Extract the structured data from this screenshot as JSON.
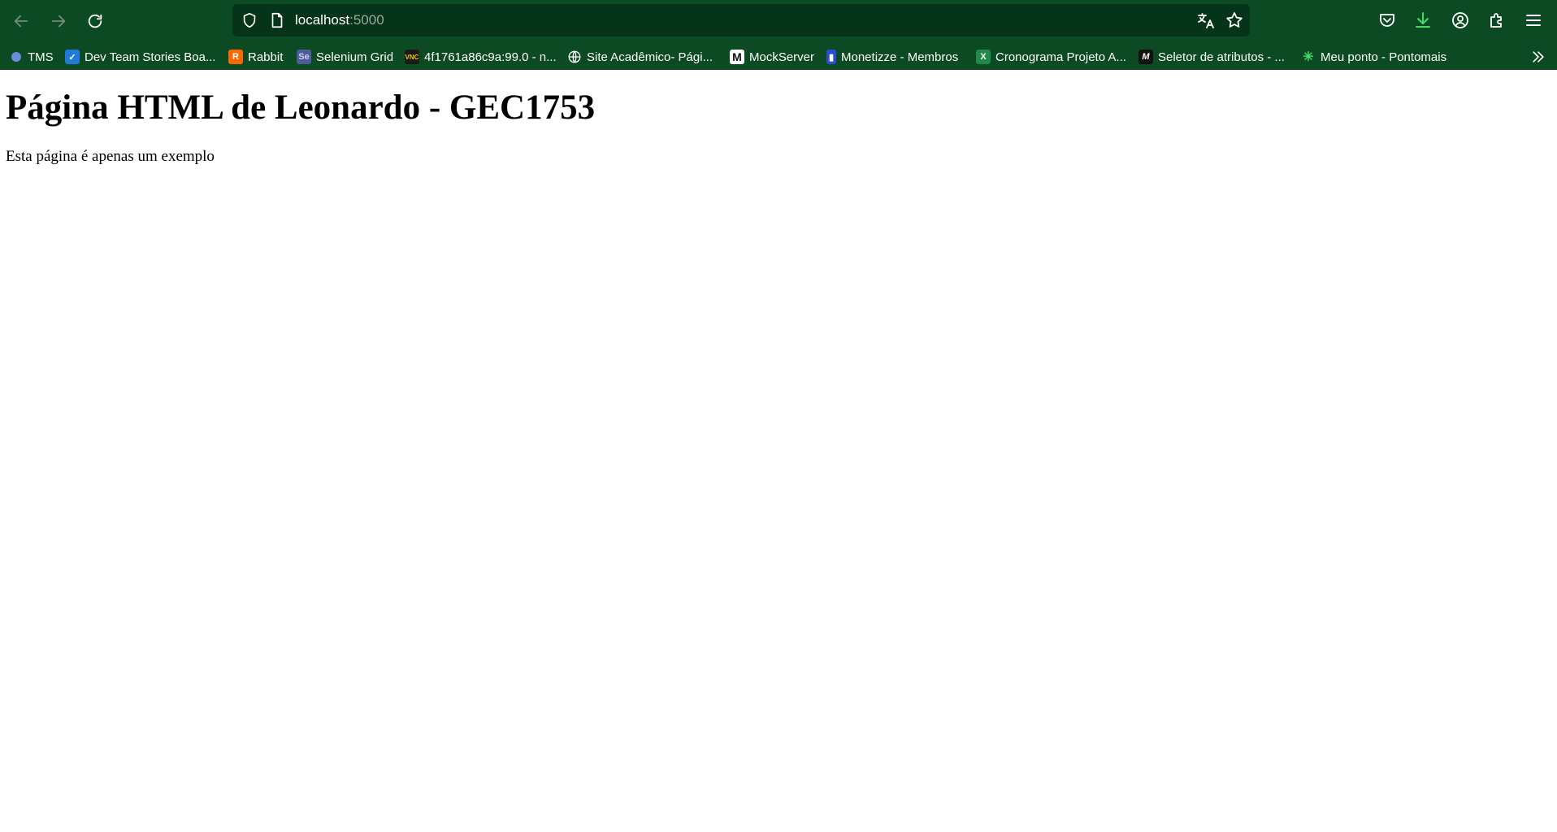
{
  "browser": {
    "url_host": "localhost",
    "url_port": ":5000"
  },
  "bookmarks": [
    {
      "label": "TMS",
      "icon": "tms-icon"
    },
    {
      "label": "Dev Team Stories Boa...",
      "icon": "azure-devops-icon"
    },
    {
      "label": "Rabbit",
      "icon": "rabbitmq-icon"
    },
    {
      "label": "Selenium Grid",
      "icon": "selenium-icon"
    },
    {
      "label": "4f1761a86c9a:99.0 - n...",
      "icon": "vnc-icon"
    },
    {
      "label": "Site Acadêmico- Pági...",
      "icon": "globe-icon"
    },
    {
      "label": "MockServer",
      "icon": "mockserver-icon"
    },
    {
      "label": "Monetizze - Membros",
      "icon": "monetizze-icon"
    },
    {
      "label": "Cronograma Projeto A...",
      "icon": "excel-icon"
    },
    {
      "label": "Seletor de atributos - ...",
      "icon": "seletor-icon"
    },
    {
      "label": "Meu ponto - Pontomais",
      "icon": "pontomais-icon"
    }
  ],
  "page": {
    "heading": "Página HTML de Leonardo - GEC1753",
    "text": "Esta página é apenas um exemplo"
  },
  "colors": {
    "chrome_bg": "#0b4a22",
    "urlbar_bg": "#053419"
  }
}
